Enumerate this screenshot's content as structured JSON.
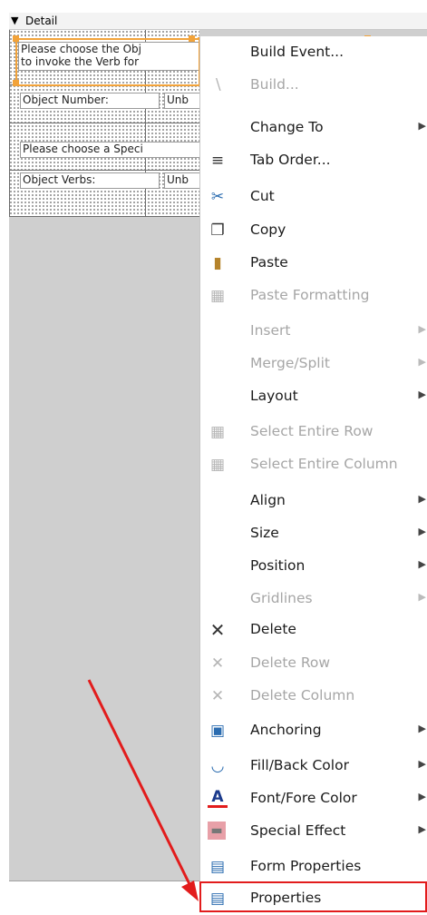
{
  "section": {
    "label": "Detail"
  },
  "controls": [
    {
      "id": "label1",
      "line1": "Please choose the Obj",
      "line2": "to invoke the Verb for"
    },
    {
      "id": "label2",
      "text": "Object Number:"
    },
    {
      "id": "box2",
      "text": "Unb"
    },
    {
      "id": "label3",
      "text": "Please choose a Speci"
    },
    {
      "id": "label4",
      "text": "Object Verbs:"
    },
    {
      "id": "box4",
      "text": "Unb"
    }
  ],
  "menu": {
    "items": [
      {
        "label": "Build Event...",
        "icon": "none",
        "disabled": false,
        "submenu": false
      },
      {
        "label": "Build...",
        "icon": "wand-icon",
        "disabled": true,
        "submenu": false
      },
      {
        "label": "Change To",
        "icon": "none",
        "disabled": false,
        "submenu": true
      },
      {
        "label": "Tab Order...",
        "icon": "tab-order-icon",
        "disabled": false,
        "submenu": false
      },
      {
        "label": "Cut",
        "icon": "scissors-icon",
        "disabled": false,
        "submenu": false
      },
      {
        "label": "Copy",
        "icon": "copy-icon",
        "disabled": false,
        "submenu": false
      },
      {
        "label": "Paste",
        "icon": "clipboard-icon",
        "disabled": false,
        "submenu": false
      },
      {
        "label": "Paste Formatting",
        "icon": "paste-formatting-icon",
        "disabled": true,
        "submenu": false
      },
      {
        "label": "Insert",
        "icon": "none",
        "disabled": true,
        "submenu": true
      },
      {
        "label": "Merge/Split",
        "icon": "none",
        "disabled": true,
        "submenu": true
      },
      {
        "label": "Layout",
        "icon": "none",
        "disabled": false,
        "submenu": true
      },
      {
        "label": "Select Entire Row",
        "icon": "table-row-icon",
        "disabled": true,
        "submenu": false
      },
      {
        "label": "Select Entire Column",
        "icon": "table-column-icon",
        "disabled": true,
        "submenu": false
      },
      {
        "label": "Align",
        "icon": "none",
        "disabled": false,
        "submenu": true
      },
      {
        "label": "Size",
        "icon": "none",
        "disabled": false,
        "submenu": true
      },
      {
        "label": "Position",
        "icon": "none",
        "disabled": false,
        "submenu": true
      },
      {
        "label": "Gridlines",
        "icon": "none",
        "disabled": true,
        "submenu": true
      },
      {
        "label": "Delete",
        "icon": "delete-x-icon",
        "disabled": false,
        "submenu": false
      },
      {
        "label": "Delete Row",
        "icon": "delete-row-icon",
        "disabled": true,
        "submenu": false
      },
      {
        "label": "Delete Column",
        "icon": "delete-column-icon",
        "disabled": true,
        "submenu": false
      },
      {
        "label": "Anchoring",
        "icon": "anchoring-icon",
        "disabled": false,
        "submenu": true
      },
      {
        "label": "Fill/Back Color",
        "icon": "fill-bucket-icon",
        "disabled": false,
        "submenu": true
      },
      {
        "label": "Font/Fore Color",
        "icon": "font-color-icon",
        "disabled": false,
        "submenu": true
      },
      {
        "label": "Special Effect",
        "icon": "special-effect-icon",
        "disabled": false,
        "submenu": true
      },
      {
        "label": "Form Properties",
        "icon": "form-properties-icon",
        "disabled": false,
        "submenu": false
      },
      {
        "label": "Properties",
        "icon": "properties-icon",
        "disabled": false,
        "submenu": false
      }
    ]
  },
  "colors": {
    "selection": "#f2a33a",
    "highlight": "#e21c1c",
    "disabled": "#a6a6a6"
  }
}
